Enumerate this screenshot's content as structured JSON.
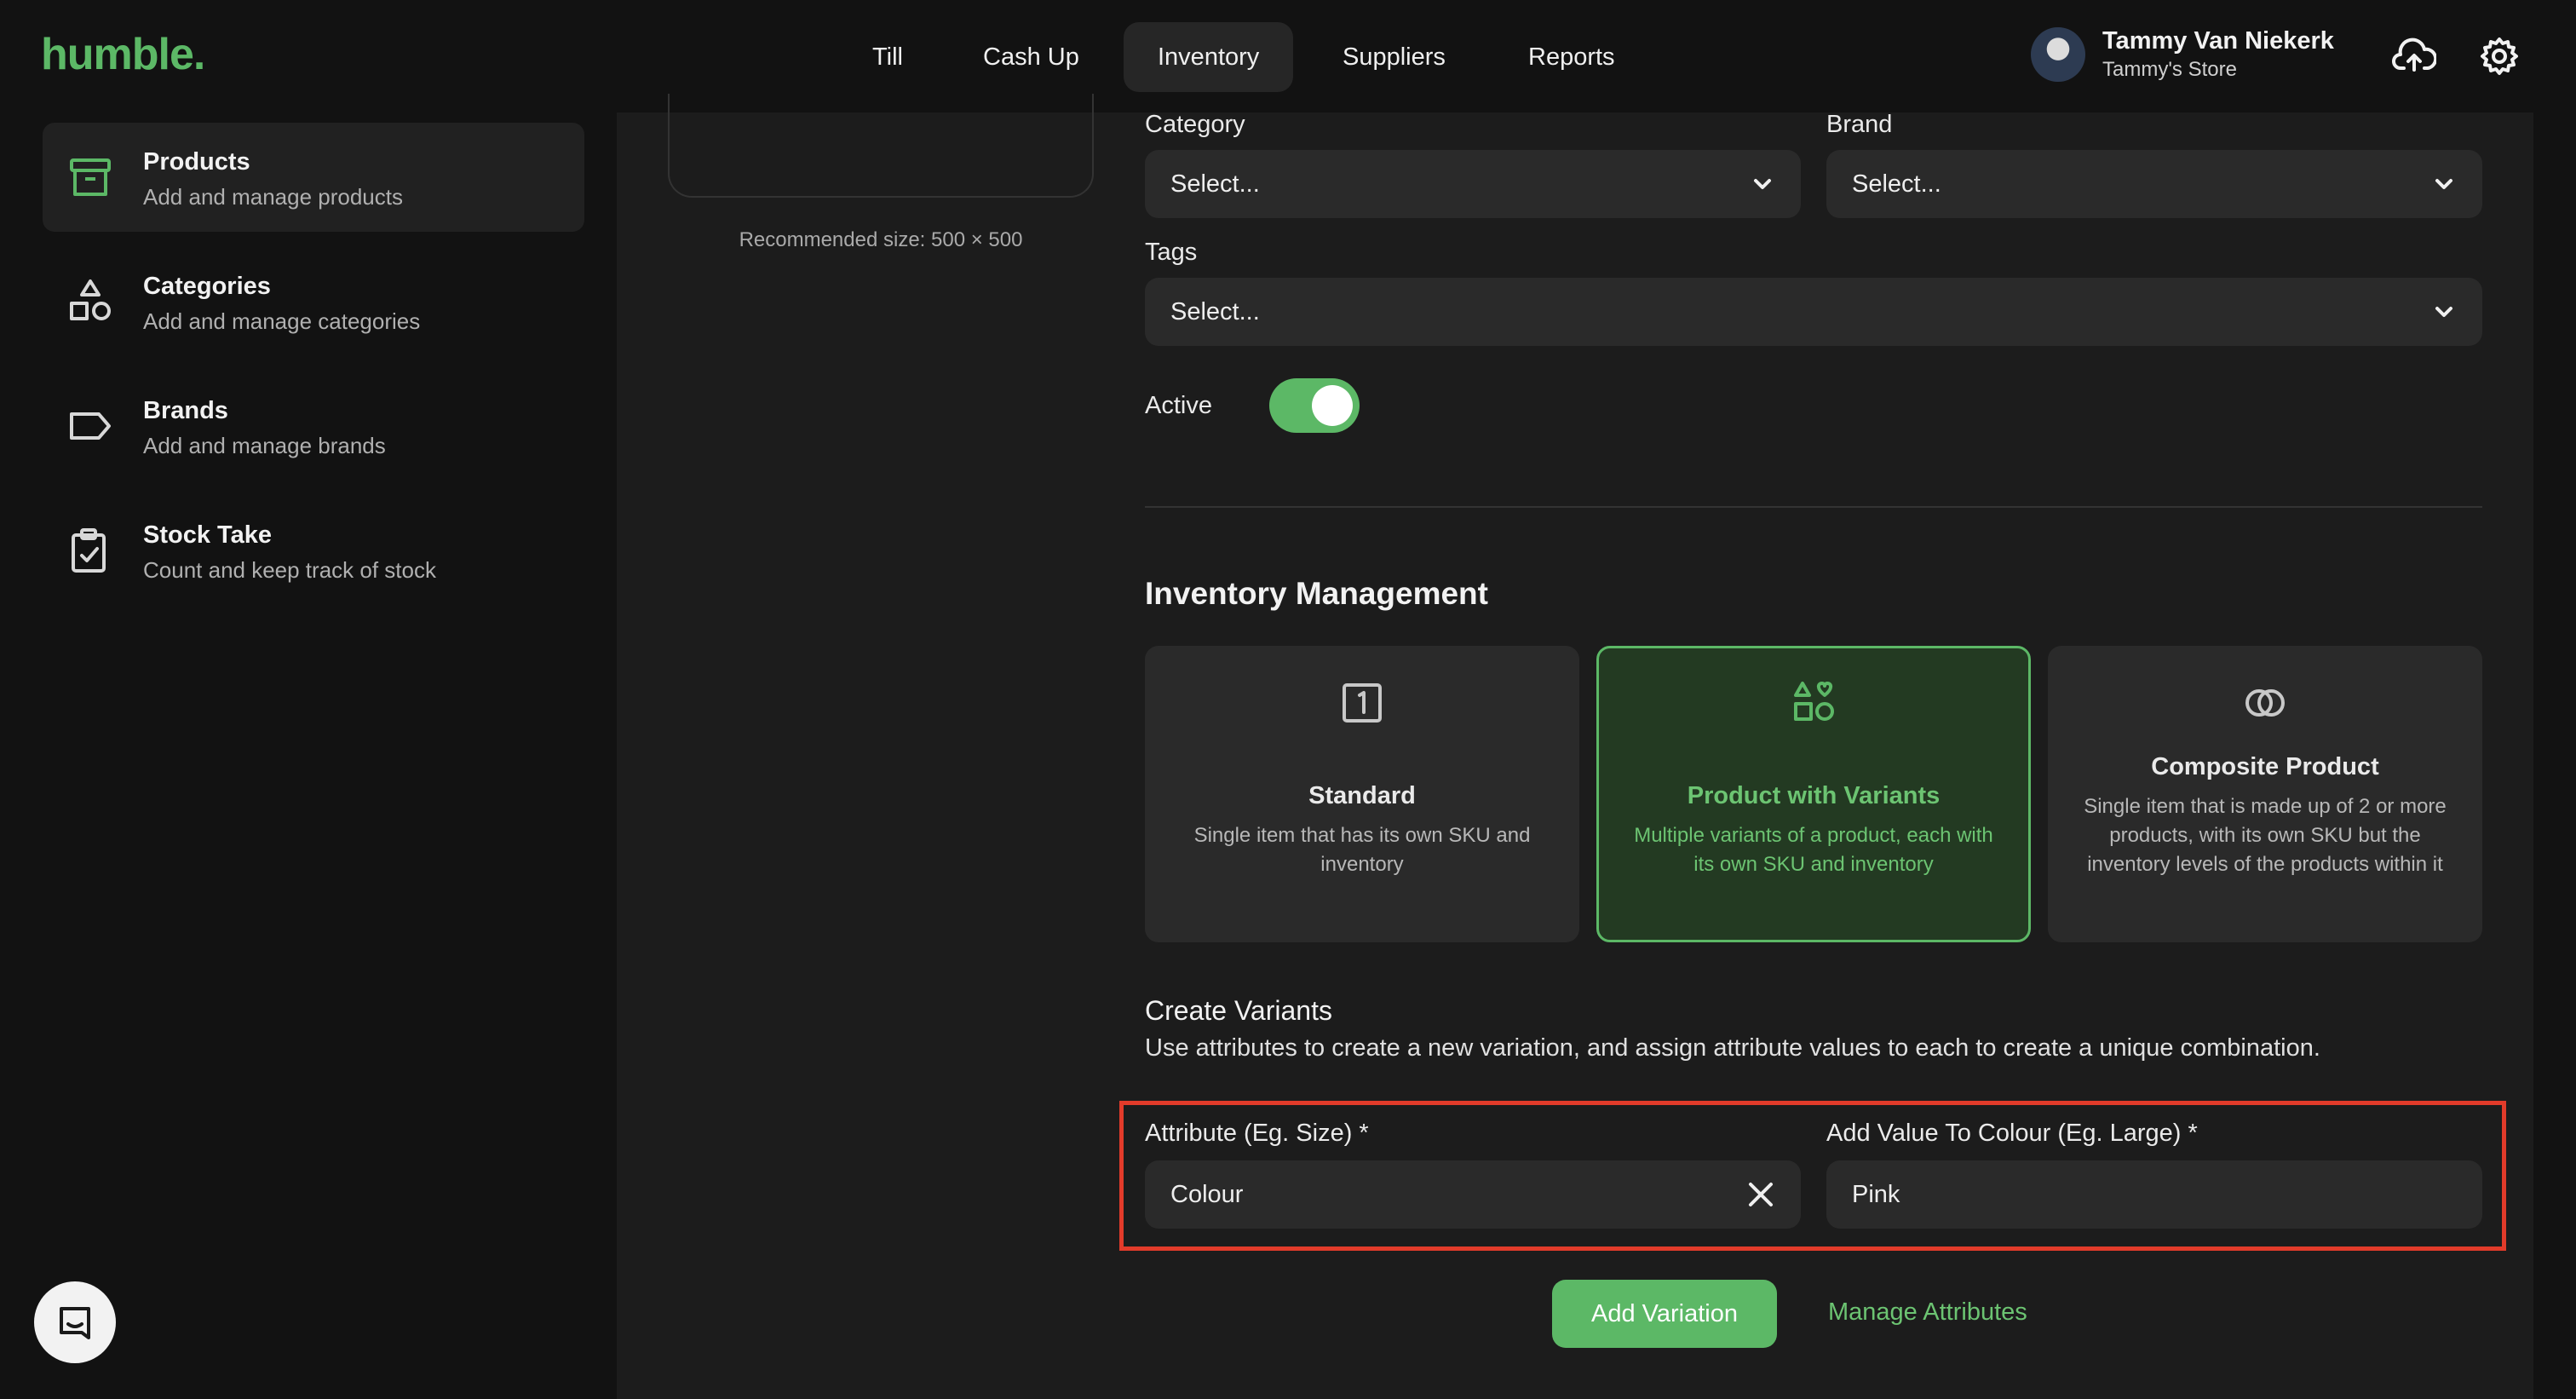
{
  "app": {
    "logo": "humble."
  },
  "nav": {
    "items": [
      {
        "label": "Till"
      },
      {
        "label": "Cash Up"
      },
      {
        "label": "Inventory"
      },
      {
        "label": "Suppliers"
      },
      {
        "label": "Reports"
      }
    ],
    "active": "Inventory"
  },
  "user": {
    "name": "Tammy Van Niekerk",
    "store": "Tammy's Store"
  },
  "sidebar": {
    "items": [
      {
        "title": "Products",
        "subtitle": "Add and manage products",
        "icon": "archive-icon"
      },
      {
        "title": "Categories",
        "subtitle": "Add and manage categories",
        "icon": "shapes-icon"
      },
      {
        "title": "Brands",
        "subtitle": "Add and manage brands",
        "icon": "tag-icon"
      },
      {
        "title": "Stock Take",
        "subtitle": "Count and keep track of stock",
        "icon": "clipboard-check-icon"
      }
    ]
  },
  "form": {
    "image_hint": "Recommended size: 500 × 500",
    "category": {
      "label": "Category",
      "value": "Select..."
    },
    "brand": {
      "label": "Brand",
      "value": "Select..."
    },
    "tags": {
      "label": "Tags",
      "value": "Select..."
    },
    "active": {
      "label": "Active",
      "on": true
    }
  },
  "inventory": {
    "title": "Inventory Management",
    "options": [
      {
        "title": "Standard",
        "desc": "Single item that has its own SKU and inventory",
        "selected": false
      },
      {
        "title": "Product with Variants",
        "desc": "Multiple variants of a product, each with its own SKU and inventory",
        "selected": true
      },
      {
        "title": "Composite Product",
        "desc": "Single item that is made up of 2 or more products, with its own SKU but the inventory levels of the products within it",
        "selected": false
      }
    ]
  },
  "variants": {
    "title": "Create Variants",
    "desc": "Use attributes to create a new variation, and assign attribute values to each to create a unique combination.",
    "attribute": {
      "label": "Attribute (Eg. Size) *",
      "value": "Colour"
    },
    "value_field": {
      "label": "Add Value To Colour (Eg. Large) *",
      "value": "Pink"
    },
    "add_button": "Add Variation",
    "manage_link": "Manage Attributes"
  },
  "colors": {
    "accent": "#5cb866",
    "highlight": "#e23b2a",
    "background": "#121212",
    "panel": "#1c1c1c"
  }
}
